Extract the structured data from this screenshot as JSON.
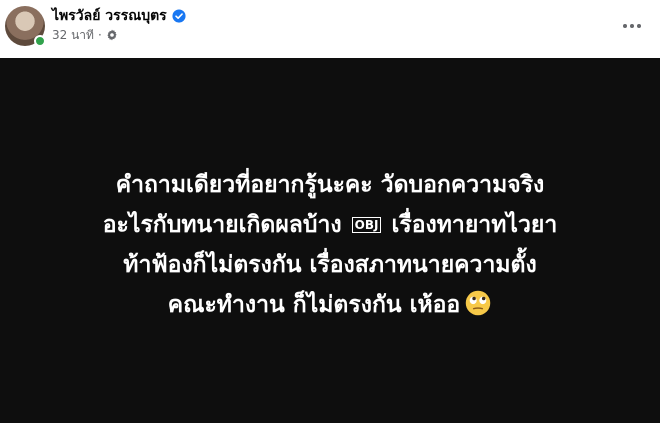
{
  "post": {
    "author_name": "ไพรวัลย์ วรรณบุตร",
    "timestamp": "32 นาที",
    "separator": "·",
    "verified": true,
    "audience_icon": "gear-icon",
    "more_icon": "more-options-icon"
  },
  "content": {
    "background_color": "#0e0e0e",
    "text_color": "#ffffff",
    "line1": "คำถามเดียวที่อยากรู้นะคะ วัดบอกความจริง",
    "line2_a": "อะไรกับทนายเกิดผลบ้าง",
    "line2_obj": "OBJ",
    "line2_b": "เรื่องทายาทไวยา",
    "line3": "ท้าฟ้องก็ไม่ตรงกัน เรื่องสภาทนายความตั้ง",
    "line4": "คณะทำงาน ก็ไม่ตรงกัน เห้ออ",
    "emoji": "face-with-rolling-eyes-icon"
  },
  "colors": {
    "verified_blue": "#1877f2",
    "online_green": "#31a24c",
    "meta_gray": "#65676b"
  }
}
